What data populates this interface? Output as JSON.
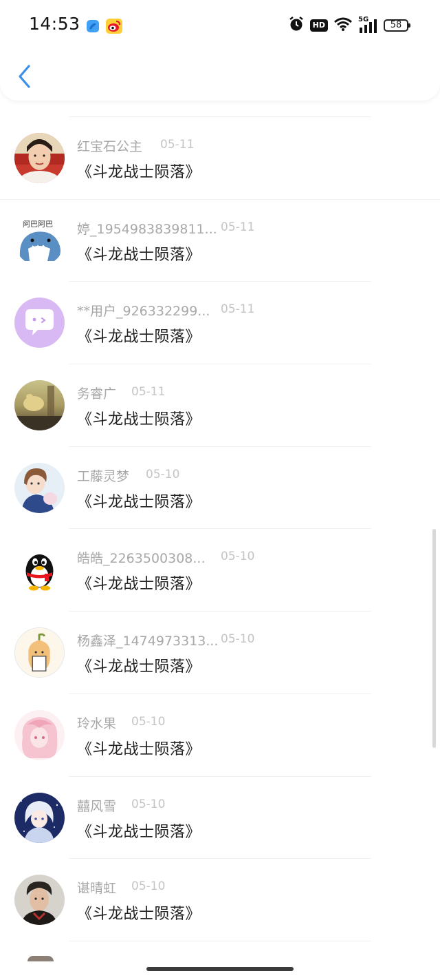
{
  "status_bar": {
    "time": "14:53",
    "network": "5G",
    "hd": "HD",
    "battery": "58",
    "app_icons": [
      "app-icon-blue",
      "weibo-icon"
    ]
  },
  "header": {
    "back_icon": "chevron-left-icon",
    "accent_color": "#3b8fe8"
  },
  "list": {
    "items": [
      {
        "username": "红宝石公主",
        "date": "05-11",
        "title": "《斗龙战士陨落》",
        "avatar": "photo-woman-red"
      },
      {
        "username": "婷_1954983839811...",
        "date": "05-11",
        "title": "《斗龙战士陨落》",
        "avatar": "cartoon-shark"
      },
      {
        "username": "**用户_926332299...",
        "date": "05-11",
        "title": "《斗龙战士陨落》",
        "avatar": "default-chat-purple"
      },
      {
        "username": "务睿广",
        "date": "05-11",
        "title": "《斗龙战士陨落》",
        "avatar": "photo-sunset"
      },
      {
        "username": "工藤灵梦",
        "date": "05-10",
        "title": "《斗龙战士陨落》",
        "avatar": "anime-boy"
      },
      {
        "username": "皓皓_2263500308...",
        "date": "05-10",
        "title": "《斗龙战士陨落》",
        "avatar": "qq-penguin"
      },
      {
        "username": "杨鑫泽_1474973313...",
        "date": "05-10",
        "title": "《斗龙战士陨落》",
        "avatar": "cartoon-pear"
      },
      {
        "username": "玲水果",
        "date": "05-10",
        "title": "《斗龙战士陨落》",
        "avatar": "anime-pink-girl"
      },
      {
        "username": "囍风雪",
        "date": "05-10",
        "title": "《斗龙战士陨落》",
        "avatar": "anime-white-girl"
      },
      {
        "username": "谌晴虹",
        "date": "05-10",
        "title": "《斗龙战士陨落》",
        "avatar": "photo-man"
      }
    ]
  }
}
